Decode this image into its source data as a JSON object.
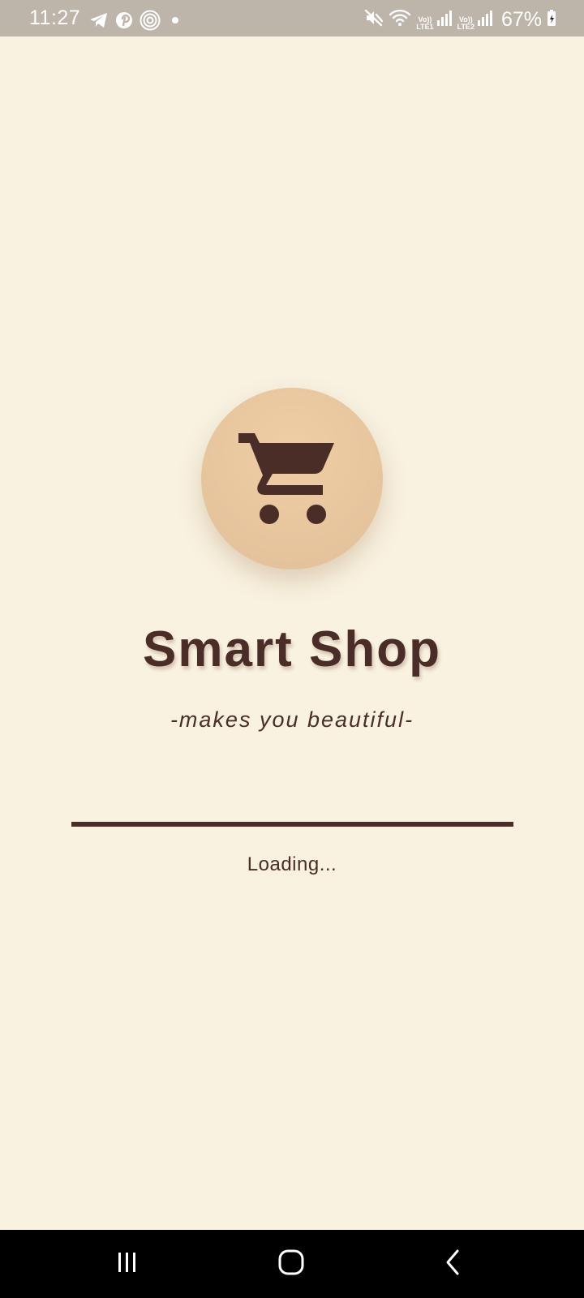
{
  "status_bar": {
    "time": "11:27",
    "battery": "67%",
    "sim1": {
      "volte": "Vo))",
      "label": "LTE1"
    },
    "sim2": {
      "volte": "Vo))",
      "label": "LTE2"
    },
    "left_icons": [
      "telegram-icon",
      "pinterest-icon",
      "fingerprint-icon",
      "dot-icon"
    ],
    "right_icons": [
      "mute-icon",
      "wifi-icon",
      "signal-icon",
      "battery-icon"
    ]
  },
  "splash": {
    "logo_icon": "shopping-cart-icon",
    "title": "Smart Shop",
    "tagline": "-makes you beautiful-",
    "loading_text": "Loading...",
    "progress": 1.0
  },
  "nav_bar": {
    "buttons": [
      "recent-apps-icon",
      "home-icon",
      "back-icon"
    ]
  },
  "colors": {
    "background": "#F9F2E1",
    "primary": "#4A2D26",
    "logo_circle": "#E5C49C",
    "status_bar": "#BDB5AA"
  }
}
